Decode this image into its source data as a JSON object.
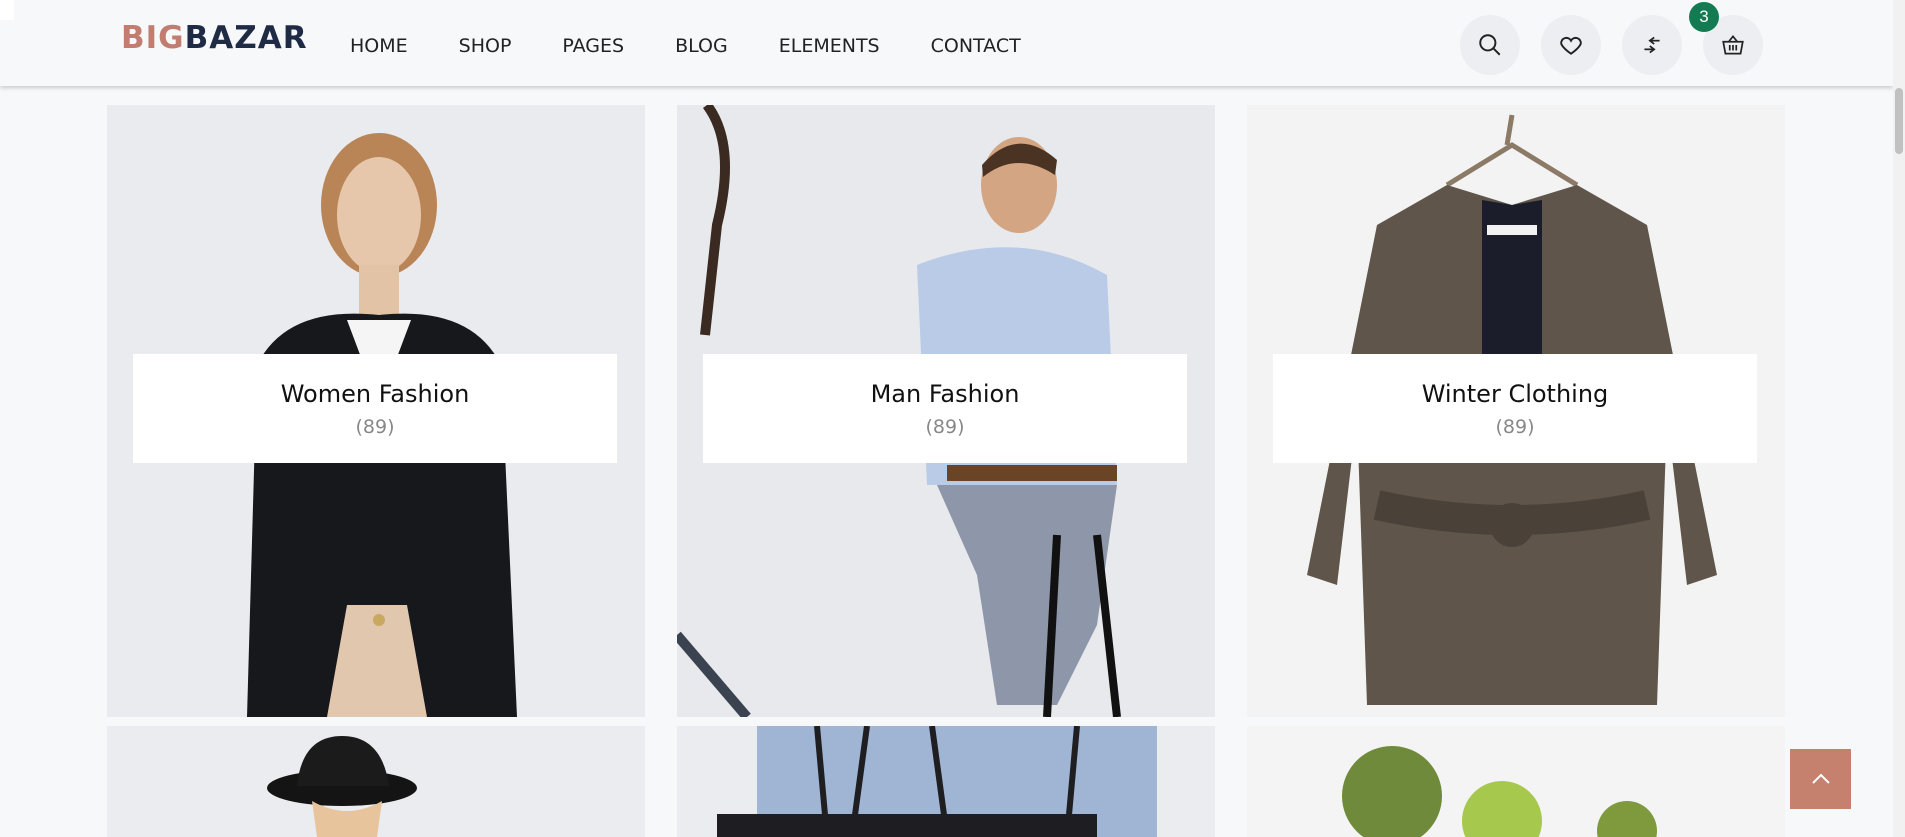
{
  "brand": {
    "part1": "BIG",
    "part2": "BAZAR"
  },
  "nav": {
    "items": [
      {
        "label": "HOME"
      },
      {
        "label": "SHOP"
      },
      {
        "label": "PAGES"
      },
      {
        "label": "BLOG"
      },
      {
        "label": "ELEMENTS"
      },
      {
        "label": "CONTACT"
      }
    ]
  },
  "header_icons": [
    "search-icon",
    "heart-icon",
    "compare-icon",
    "basket-icon"
  ],
  "cart": {
    "count": "3"
  },
  "categories": [
    {
      "title": "Women Fashion",
      "count": "(89)"
    },
    {
      "title": "Man Fashion",
      "count": "(89)"
    },
    {
      "title": "Winter Clothing",
      "count": "(89)"
    }
  ],
  "colors": {
    "brand_accent": "#c27d71",
    "brand_dark": "#1f2a44",
    "badge": "#137b52",
    "back_to_top": "#c5806e"
  }
}
